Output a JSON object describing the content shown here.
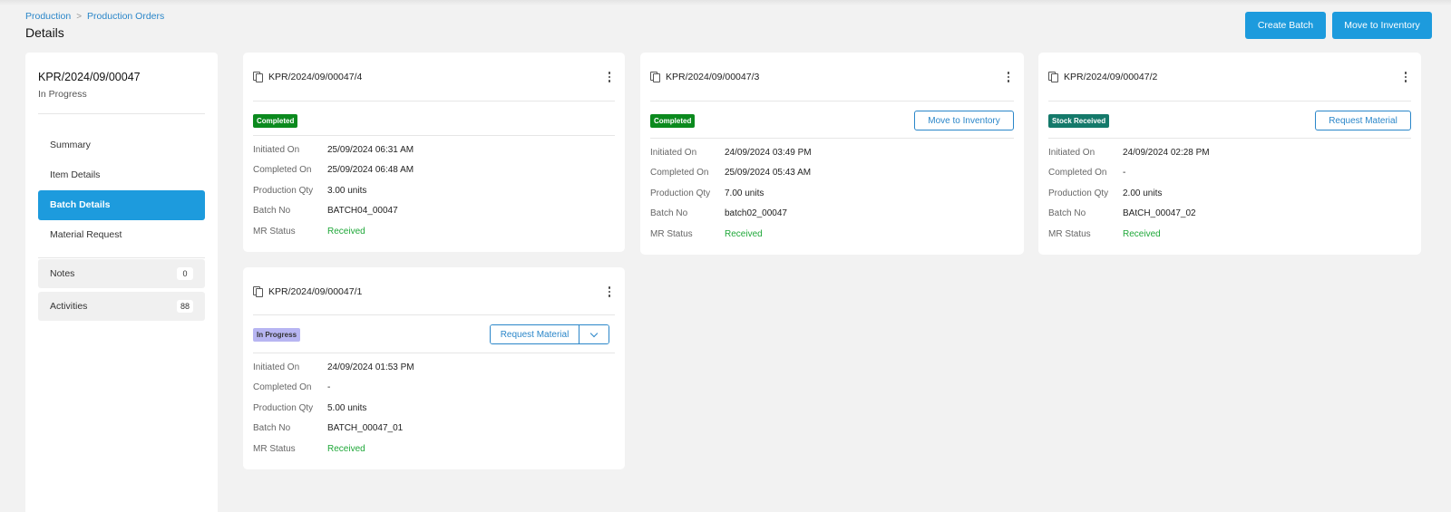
{
  "breadcrumb": {
    "items": [
      "Production",
      "Production Orders"
    ],
    "separator": ">"
  },
  "page_title": "Details",
  "header_actions": {
    "create_batch": "Create Batch",
    "move_to_inventory": "Move to Inventory"
  },
  "sidebar": {
    "order_no": "KPR/2024/09/00047",
    "status": "In Progress",
    "nav": [
      "Summary",
      "Item Details",
      "Batch Details",
      "Material Request"
    ],
    "active_nav": "Batch Details",
    "notes": {
      "label": "Notes",
      "count": "0"
    },
    "activities": {
      "label": "Activities",
      "count": "88"
    }
  },
  "labels": {
    "initiated_on": "Initiated On",
    "completed_on": "Completed On",
    "production_qty": "Production Qty",
    "batch_no": "Batch No",
    "mr_status": "MR Status"
  },
  "batches": [
    {
      "id": "KPR/2024/09/00047/4",
      "status": "Completed",
      "action": "",
      "initiated_on": "25/09/2024 06:31 AM",
      "completed_on": "25/09/2024 06:48 AM",
      "production_qty": "3.00 units",
      "batch_no": "BATCH04_00047",
      "mr_status": "Received"
    },
    {
      "id": "KPR/2024/09/00047/3",
      "status": "Completed",
      "action": "Move to Inventory",
      "initiated_on": "24/09/2024 03:49 PM",
      "completed_on": "25/09/2024 05:43 AM",
      "production_qty": "7.00 units",
      "batch_no": "batch02_00047",
      "mr_status": "Received"
    },
    {
      "id": "KPR/2024/09/00047/2",
      "status": "Stock Received",
      "action": "Request Material",
      "initiated_on": "24/09/2024 02:28 PM",
      "completed_on": "-",
      "production_qty": "2.00 units",
      "batch_no": "BAtCH_00047_02",
      "mr_status": "Received"
    },
    {
      "id": "KPR/2024/09/00047/1",
      "status": "In Progress",
      "action": "Request Material",
      "initiated_on": "24/09/2024 01:53 PM",
      "completed_on": "-",
      "production_qty": "5.00 units",
      "batch_no": "BATCH_00047_01",
      "mr_status": "Received"
    }
  ],
  "colors": {
    "primary": "#1d9bdd",
    "link": "#2a86c9",
    "completed": "#0b8a1e",
    "stock_received": "#14796a",
    "in_progress": "#b7b5f2",
    "received_text": "#1fa839"
  }
}
